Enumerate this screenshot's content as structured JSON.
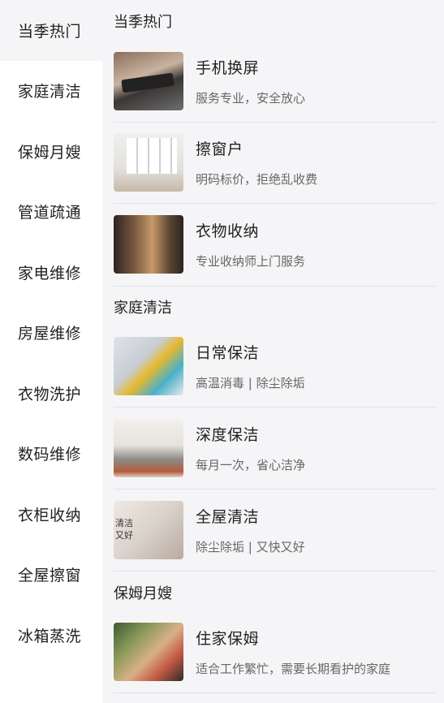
{
  "sidebar": {
    "items": [
      {
        "label": "当季热门"
      },
      {
        "label": "家庭清洁"
      },
      {
        "label": "保姆月嫂"
      },
      {
        "label": "管道疏通"
      },
      {
        "label": "家电维修"
      },
      {
        "label": "房屋维修"
      },
      {
        "label": "衣物洗护"
      },
      {
        "label": "数码维修"
      },
      {
        "label": "衣柜收纳"
      },
      {
        "label": "全屋擦窗"
      },
      {
        "label": "冰箱蒸洗"
      }
    ]
  },
  "sections": [
    {
      "title": "当季热门",
      "items": [
        {
          "title": "手机换屏",
          "subtitle": "服务专业，安全放心"
        },
        {
          "title": "擦窗户",
          "subtitle": "明码标价，拒绝乱收费"
        },
        {
          "title": "衣物收纳",
          "subtitle": "专业收纳师上门服务"
        }
      ]
    },
    {
      "title": "家庭清洁",
      "items": [
        {
          "title": "日常保洁",
          "subtitle": "高温消毒 | 除尘除垢"
        },
        {
          "title": "深度保洁",
          "subtitle": "每月一次，省心洁净"
        },
        {
          "title": "全屋清洁",
          "subtitle": "除尘除垢 | 又快又好",
          "image_text": [
            "清洁",
            "又好"
          ]
        }
      ]
    },
    {
      "title": "保姆月嫂",
      "items": [
        {
          "title": "住家保姆",
          "subtitle": "适合工作繁忙，需要长期看护的家庭"
        }
      ]
    }
  ]
}
